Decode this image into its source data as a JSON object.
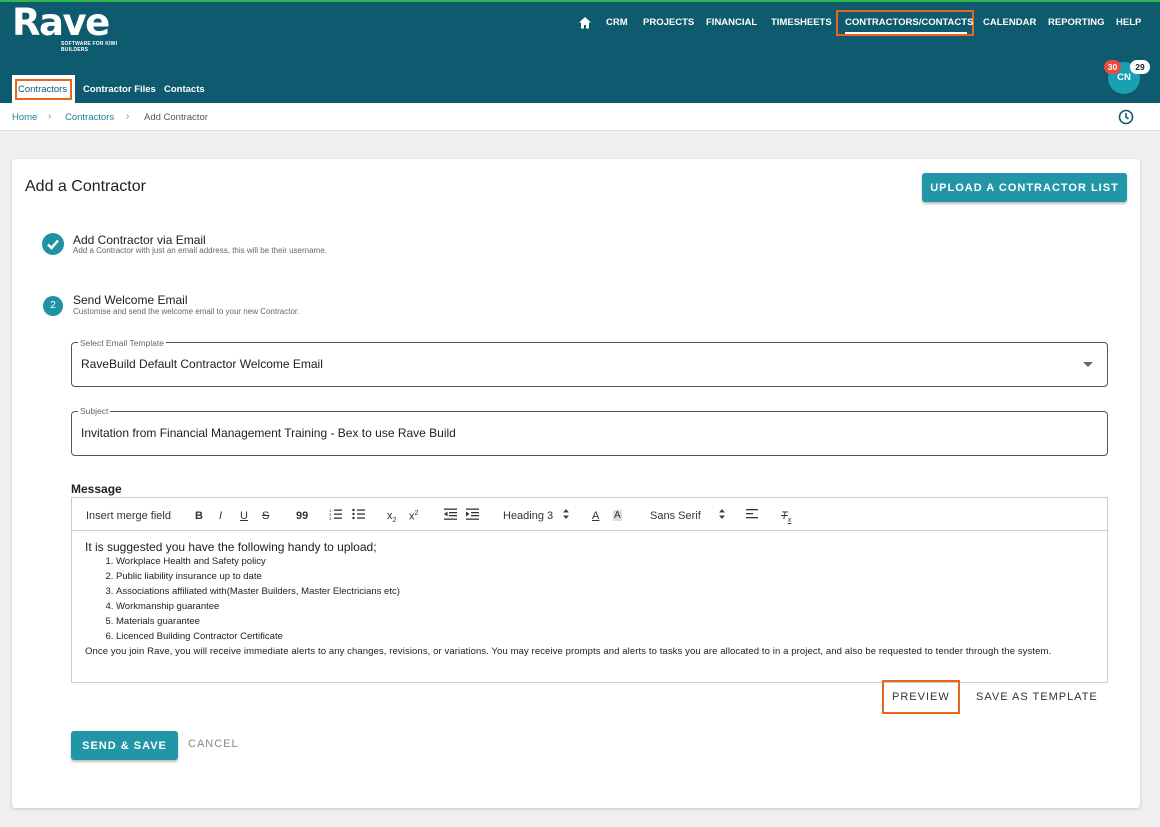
{
  "brand": {
    "name": "Rave",
    "tagline": "SOFTWARE FOR KIWI BUILDERS",
    "accent": "#0e5a6e",
    "button_color": "#2196a6",
    "highlight": "#e8671e"
  },
  "nav": {
    "home_icon": "home-icon",
    "items": [
      "CRM",
      "PROJECTS",
      "FINANCIAL",
      "TIMESHEETS",
      "CONTRACTORS/CONTACTS",
      "CALENDAR",
      "REPORTING",
      "HELP"
    ],
    "active": "CONTRACTORS/CONTACTS"
  },
  "subtabs": {
    "items": [
      "Contractors",
      "Contractor Files",
      "Contacts"
    ],
    "active": "Contractors"
  },
  "user": {
    "initials": "CN",
    "badge_red": "30",
    "badge_white": "29"
  },
  "breadcrumb": {
    "home": "Home",
    "section": "Contractors",
    "current": "Add Contractor"
  },
  "page": {
    "title": "Add a Contractor",
    "upload_label": "UPLOAD A CONTRACTOR LIST"
  },
  "steps": [
    {
      "status": "done",
      "title": "Add Contractor via Email",
      "subtitle": "Add a Contractor with just an email address, this will be their username."
    },
    {
      "number": "2",
      "title": "Send Welcome Email",
      "subtitle": "Customise and send the welcome email to your new Contractor."
    }
  ],
  "template_field": {
    "label": "Select Email Template",
    "value": "RaveBuild Default Contractor Welcome Email"
  },
  "subject_field": {
    "label": "Subject",
    "value": "Invitation from Financial Management Training - Bex to use Rave Build"
  },
  "message": {
    "label": "Message",
    "toolbar": {
      "merge_field": "Insert merge field",
      "bold": "B",
      "italic": "I",
      "underline": "U",
      "strike": "S",
      "quote": "99",
      "heading": "Heading 3",
      "font": "Sans Serif",
      "sub": "x",
      "sup": "x"
    },
    "intro": "It is suggested you have the following handy to upload;",
    "list": [
      "Workplace Health and Safety policy",
      "Public liability insurance up to date",
      "Associations affiliated with(Master Builders, Master Electricians etc)",
      "Workmanship guarantee",
      "Materials guarantee",
      "Licenced Building Contractor Certificate"
    ],
    "outro": "Once you join Rave, you will receive immediate alerts to any changes, revisions, or variations. You may receive prompts and alerts to tasks you are allocated to in a project, and also be requested to tender through the system."
  },
  "actions": {
    "preview": "PREVIEW",
    "save_template": "SAVE AS TEMPLATE",
    "send_save": "SEND & SAVE",
    "cancel": "CANCEL"
  }
}
